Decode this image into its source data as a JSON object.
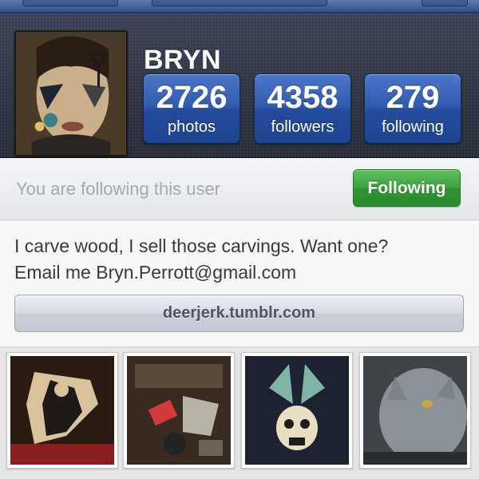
{
  "profile": {
    "username": "BRYN",
    "stats": [
      {
        "value": "2726",
        "label": "photos"
      },
      {
        "value": "4358",
        "label": "followers"
      },
      {
        "value": "279",
        "label": "following"
      }
    ]
  },
  "follow": {
    "status_text": "You are following this user",
    "button_label": "Following"
  },
  "bio": {
    "line1": "I carve wood, I sell those carvings. Want one?",
    "line2": "Email me Bryn.Perrott@gmail.com",
    "website": "deerjerk.tumblr.com"
  },
  "colors": {
    "stat_blue": "#2f5aad",
    "follow_green": "#3aa23d",
    "header_dark": "#2e3443"
  }
}
